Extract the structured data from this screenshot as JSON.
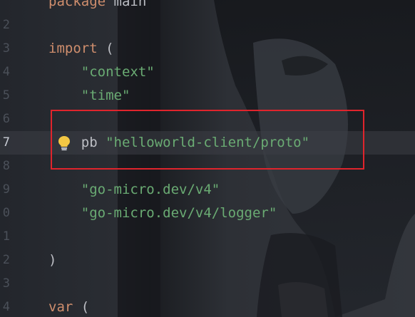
{
  "editor": {
    "lines": [
      {
        "num": "",
        "parts": [
          {
            "cls": "kw",
            "text": "package "
          },
          {
            "cls": "plain",
            "text": "main"
          }
        ]
      },
      {
        "num": "2",
        "parts": []
      },
      {
        "num": "3",
        "parts": [
          {
            "cls": "kw",
            "text": "import "
          },
          {
            "cls": "plain",
            "text": "("
          }
        ]
      },
      {
        "num": "4",
        "parts": [
          {
            "cls": "str",
            "text": "    \"context\""
          }
        ]
      },
      {
        "num": "5",
        "parts": [
          {
            "cls": "str",
            "text": "    \"time\""
          }
        ]
      },
      {
        "num": "6",
        "parts": []
      },
      {
        "num": "7",
        "current": true,
        "parts": [
          {
            "cls": "plain",
            "text": "    pb "
          },
          {
            "cls": "str",
            "text": "\"helloworld-client/proto\""
          }
        ]
      },
      {
        "num": "8",
        "parts": []
      },
      {
        "num": "9",
        "parts": [
          {
            "cls": "str",
            "text": "    \"go-micro.dev/v4\""
          }
        ]
      },
      {
        "num": "0",
        "parts": [
          {
            "cls": "str",
            "text": "    \"go-micro.dev/v4/logger\""
          }
        ]
      },
      {
        "num": "1",
        "parts": []
      },
      {
        "num": "2",
        "parts": [
          {
            "cls": "plain",
            "text": ")"
          }
        ]
      },
      {
        "num": "3",
        "parts": []
      },
      {
        "num": "4",
        "parts": [
          {
            "cls": "kw",
            "text": "var "
          },
          {
            "cls": "plain",
            "text": "("
          }
        ]
      }
    ],
    "intention_icon": "lightbulb-icon",
    "highlight_color": "#e0242c",
    "colors": {
      "keyword": "#cf8e6d",
      "string": "#6aab73",
      "text": "#bcbec4",
      "line_number": "#4b5059",
      "background": "#1f2127"
    }
  }
}
